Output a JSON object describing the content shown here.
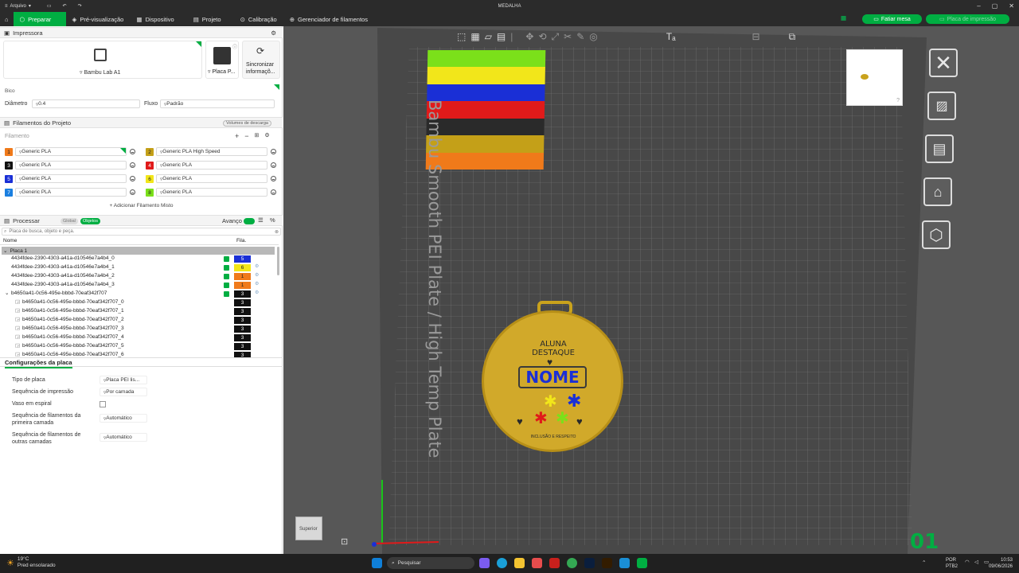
{
  "window": {
    "menu_label": "Arquivo",
    "title": "MEDALHA"
  },
  "navbar": {
    "tabs": [
      "Preparar",
      "Pré-visualização",
      "Dispositivo",
      "Projeto",
      "Calibração",
      "Gerenciador de filamentos"
    ],
    "slice_button": "Fatiar mesa",
    "print_button": "Placa de impressão"
  },
  "printer": {
    "section_title": "Impressora",
    "printer_name": "Bambu Lab A1",
    "plate_label": "Placa P...",
    "sync_label_line1": "Sincronizar",
    "sync_label_line2": "informaçõ...",
    "nozzle_label": "Bico",
    "diameter_label": "Diâmetro",
    "diameter_value": "0.4",
    "flow_label": "Fluxo",
    "flow_value": "Padrão"
  },
  "filaments": {
    "section_title": "Filamentos do Projeto",
    "volumes_button": "Volumes de descarga",
    "filament_label": "Filamento",
    "add_mixed": "Adicionar Filamento Misto",
    "items": [
      {
        "num": "1",
        "name": "Generic PLA",
        "color": "#f07a1a"
      },
      {
        "num": "2",
        "name": "Generic PLA High Speed",
        "color": "#c4a018"
      },
      {
        "num": "3",
        "name": "Generic PLA",
        "color": "#111111"
      },
      {
        "num": "4",
        "name": "Generic PLA",
        "color": "#e01a1a"
      },
      {
        "num": "5",
        "name": "Generic PLA",
        "color": "#1a2fd6"
      },
      {
        "num": "6",
        "name": "Generic PLA",
        "color": "#f2e61a"
      },
      {
        "num": "7",
        "name": "Generic PLA",
        "color": "#1a7fe0"
      },
      {
        "num": "8",
        "name": "Generic PLA",
        "color": "#7be01a"
      }
    ]
  },
  "process": {
    "section_title": "Processar",
    "global_label": "Global",
    "objects_label": "Objetos",
    "advanced_label": "Avanço",
    "search_placeholder": "Placa de busca, objeto e peça.",
    "col_name": "Nome",
    "col_fila": "Fila.",
    "plate_row": "Placa 1",
    "objects": [
      {
        "name": "4434fdee-2390-4303-a41a-d10546e7a4b4_0",
        "fila": "5",
        "color": "#1a2fd6",
        "text": "#fff",
        "indent": 1
      },
      {
        "name": "4434fdee-2390-4303-a41a-d10546e7a4b4_1",
        "fila": "6",
        "color": "#f2e61a",
        "text": "#222",
        "indent": 1
      },
      {
        "name": "4434fdee-2390-4303-a41a-d10546e7a4b4_2",
        "fila": "1",
        "color": "#f07a1a",
        "text": "#222",
        "indent": 1
      },
      {
        "name": "4434fdee-2390-4303-a41a-d10546e7a4b4_3",
        "fila": "1",
        "color": "#f07a1a",
        "text": "#222",
        "indent": 1
      },
      {
        "name": "b4650a41-0c56-495e-bbbd-70eaf342f707",
        "fila": "3",
        "color": "#111111",
        "text": "#fff",
        "indent": 0
      },
      {
        "name": "b4650a41-0c56-495e-bbbd-70eaf342f707_0",
        "fila": "3",
        "color": "#111111",
        "text": "#fff",
        "indent": 2
      },
      {
        "name": "b4650a41-0c56-495e-bbbd-70eaf342f707_1",
        "fila": "3",
        "color": "#111111",
        "text": "#fff",
        "indent": 2
      },
      {
        "name": "b4650a41-0c56-495e-bbbd-70eaf342f707_2",
        "fila": "3",
        "color": "#111111",
        "text": "#fff",
        "indent": 2
      },
      {
        "name": "b4650a41-0c56-495e-bbbd-70eaf342f707_3",
        "fila": "3",
        "color": "#111111",
        "text": "#fff",
        "indent": 2
      },
      {
        "name": "b4650a41-0c56-495e-bbbd-70eaf342f707_4",
        "fila": "3",
        "color": "#111111",
        "text": "#fff",
        "indent": 2
      },
      {
        "name": "b4650a41-0c56-495e-bbbd-70eaf342f707_5",
        "fila": "3",
        "color": "#111111",
        "text": "#fff",
        "indent": 2
      },
      {
        "name": "b4650a41-0c56-495e-bbbd-70eaf342f707_6",
        "fila": "3",
        "color": "#111111",
        "text": "#fff",
        "indent": 2
      }
    ]
  },
  "plate_settings": {
    "tab_label": "Configurações da placa",
    "rows": [
      {
        "label": "Tipo de placa",
        "value": "Placa PEI lis..."
      },
      {
        "label": "Sequência de impressão",
        "value": "Por camada"
      },
      {
        "label": "Vaso em espiral",
        "value": ""
      },
      {
        "label": "Sequência de filamentos da primeira camada",
        "value": "Automático"
      },
      {
        "label": "Sequência de filamentos de outras camadas",
        "value": "Automático"
      }
    ]
  },
  "viewport": {
    "plate_text": "Bambu Smooth PEI Plate / High Temp Plate",
    "plate_number": "01",
    "view_label": "Superior",
    "medal_line1": "ALUNA",
    "medal_line2": "DESTAQUE",
    "medal_name": "NOME",
    "medal_bottom": "INCLUSÃO E RESPEITO",
    "wipe_tower_colors": [
      "#7be01a",
      "#f2e61a",
      "#1a2fd6",
      "#e01a1a",
      "#2a2a2a",
      "#c4a018",
      "#f07a1a"
    ]
  },
  "taskbar": {
    "weather_temp": "19°C",
    "weather_desc": "Pred ensolarado",
    "search_placeholder": "Pesquisar",
    "lang_line1": "POR",
    "lang_line2": "PTB2",
    "time": "10:53",
    "date": "09/06/2026"
  }
}
